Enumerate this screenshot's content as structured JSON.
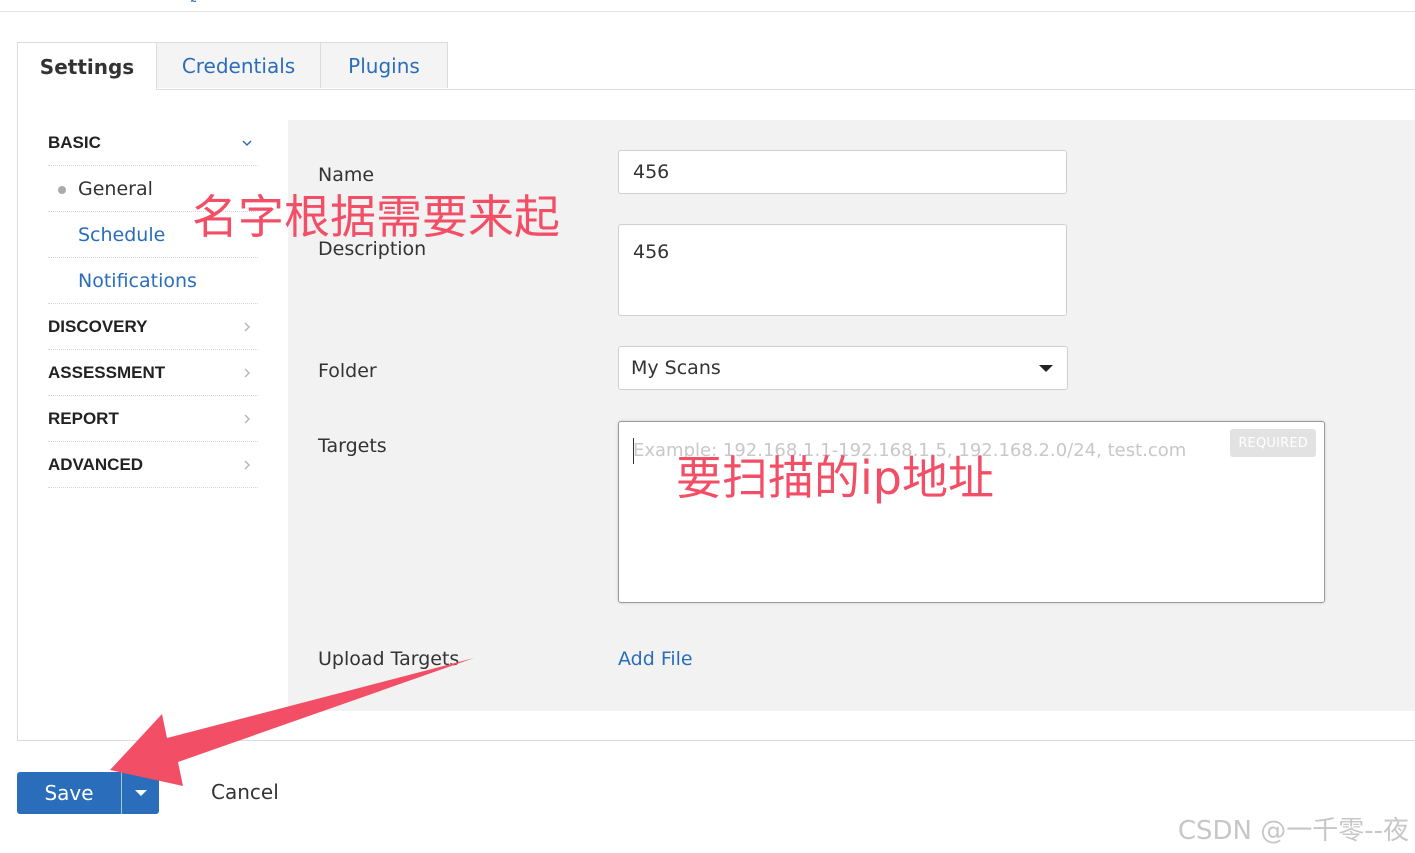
{
  "tabs": [
    {
      "label": "Settings",
      "active": true
    },
    {
      "label": "Credentials",
      "active": false
    },
    {
      "label": "Plugins",
      "active": false
    }
  ],
  "nav": {
    "basic": "BASIC",
    "general": "General",
    "schedule": "Schedule",
    "notifications": "Notifications",
    "discovery": "DISCOVERY",
    "assessment": "ASSESSMENT",
    "report": "REPORT",
    "advanced": "ADVANCED"
  },
  "form": {
    "name_label": "Name",
    "name_value": "456",
    "description_label": "Description",
    "description_value": "456",
    "folder_label": "Folder",
    "folder_value": "My Scans",
    "targets_label": "Targets",
    "targets_placeholder": "Example: 192.168.1.1-192.168.1.5, 192.168.2.0/24, test.com",
    "required_badge": "REQUIRED",
    "upload_label": "Upload Targets",
    "add_file": "Add File"
  },
  "footer": {
    "save": "Save",
    "cancel": "Cancel"
  },
  "annotations": {
    "name_note": "名字根据需要来起",
    "targets_note": "要扫描的ip地址",
    "watermark": "CSDN @一千零--夜"
  },
  "colors": {
    "accent": "#2a6ebb",
    "annotation": "#f24f67"
  }
}
